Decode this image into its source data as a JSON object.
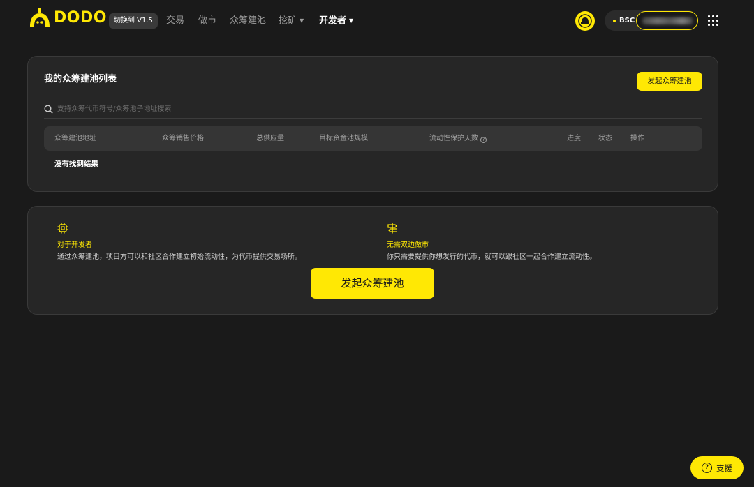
{
  "header": {
    "logo_text": "DODO",
    "version_badge": "切换到 V1.5",
    "nav": [
      {
        "label": "交易",
        "has_caret": false
      },
      {
        "label": "做市",
        "has_caret": false
      },
      {
        "label": "众筹建池",
        "has_caret": false
      },
      {
        "label": "挖矿",
        "has_caret": true
      },
      {
        "label": "开发者",
        "has_caret": true,
        "active": true
      }
    ],
    "avatar_text": "DODO",
    "chain": "BSC",
    "grid_icon": "apps-grid-icon"
  },
  "list_panel": {
    "title": "我的众筹建池列表",
    "create_button": "发起众筹建池",
    "search_placeholder": "支持众筹代币符号/众筹池子地址搜索",
    "columns": [
      "众筹建池地址",
      "众筹销售价格",
      "总供应量",
      "目标资金池规模",
      "流动性保护天数",
      "进度",
      "状态",
      "操作"
    ],
    "empty_text": "没有找到结果"
  },
  "info_panel": {
    "features": [
      {
        "icon": "chip-icon",
        "title": "对于开发者",
        "desc": "通过众筹建池，项目方可以和社区合作建立初始流动性，为代币提供交易场所。"
      },
      {
        "icon": "signpost-icon",
        "title": "无需双边做市",
        "desc": "你只需要提供你想发行的代币，就可以跟社区一起合作建立流动性。"
      }
    ],
    "create_button": "发起众筹建池"
  },
  "support": {
    "label": "支援",
    "icon": "question-icon"
  },
  "colors": {
    "accent": "#ffe804",
    "background": "#1a1a1a",
    "panel": "#262626"
  }
}
